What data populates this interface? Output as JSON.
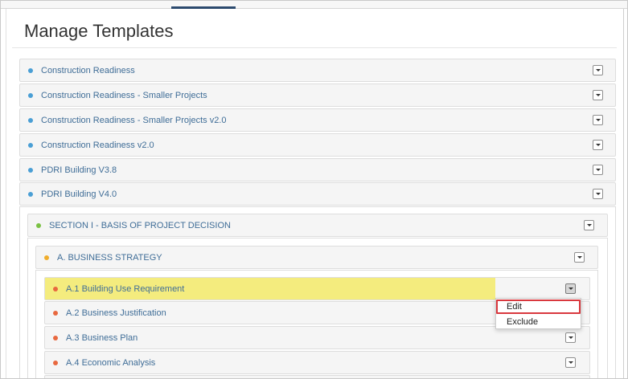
{
  "page": {
    "title": "Manage Templates"
  },
  "templates": [
    {
      "label": "Construction Readiness"
    },
    {
      "label": "Construction Readiness - Smaller Projects"
    },
    {
      "label": "Construction Readiness - Smaller Projects v2.0"
    },
    {
      "label": "Construction Readiness v2.0"
    },
    {
      "label": "PDRI Building V3.8"
    },
    {
      "label": "PDRI Building V4.0"
    }
  ],
  "section": {
    "label": "SECTION I - BASIS OF PROJECT DECISION"
  },
  "category": {
    "label": "A. BUSINESS STRATEGY"
  },
  "elements": [
    {
      "label": "A.1 Building Use Requirement"
    },
    {
      "label": "A.2 Business Justification"
    },
    {
      "label": "A.3 Business Plan"
    },
    {
      "label": "A.4 Economic Analysis"
    }
  ],
  "menu": {
    "edit": "Edit",
    "exclude": "Exclude"
  },
  "colors": {
    "template_dot": "#4a9fd5",
    "section_dot": "#7ac143",
    "category_dot": "#f0ad2c",
    "element_dot": "#e8683f",
    "highlight": "#f4ec7e",
    "link_text": "#3f6d97",
    "menu_outline": "#d9383e"
  }
}
